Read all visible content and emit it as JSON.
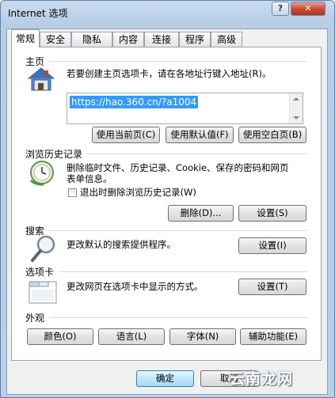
{
  "window": {
    "title": "Internet 选项",
    "help_glyph": "?",
    "close_glyph": "✕"
  },
  "tabs": [
    {
      "label": "常规",
      "active": true
    },
    {
      "label": "安全"
    },
    {
      "label": "隐私"
    },
    {
      "label": "内容"
    },
    {
      "label": "连接"
    },
    {
      "label": "程序"
    },
    {
      "label": "高级"
    }
  ],
  "home": {
    "title": "主页",
    "desc": "若要创建主页选项卡，请在各地址行键入地址(R)。",
    "address": "https://hao.360.cn/?a1004",
    "btn_current": "使用当前页(C)",
    "btn_default": "使用默认值(F)",
    "btn_blank": "使用空白页(B)"
  },
  "history": {
    "title": "浏览历史记录",
    "desc_line1": "删除临时文件、历史记录、Cookie、保存的密码和网页",
    "desc_line2": "表单信息。",
    "checkbox_label": "退出时删除浏览历史记录(W)",
    "btn_delete": "删除(D)...",
    "btn_settings": "设置(S)"
  },
  "search": {
    "title": "搜索",
    "desc": "更改默认的搜索提供程序。",
    "btn_settings": "设置(I)"
  },
  "tabs_section": {
    "title": "选项卡",
    "desc": "更改网页在选项卡中显示的方式。",
    "btn_settings": "设置(T)"
  },
  "appearance": {
    "title": "外观",
    "btn_colors": "颜色(O)",
    "btn_languages": "语言(L)",
    "btn_fonts": "字体(N)",
    "btn_accessibility": "辅助功能(E)"
  },
  "footer": {
    "btn_ok": "确定",
    "btn_cancel": "取消"
  },
  "watermark": "云南龙网"
}
